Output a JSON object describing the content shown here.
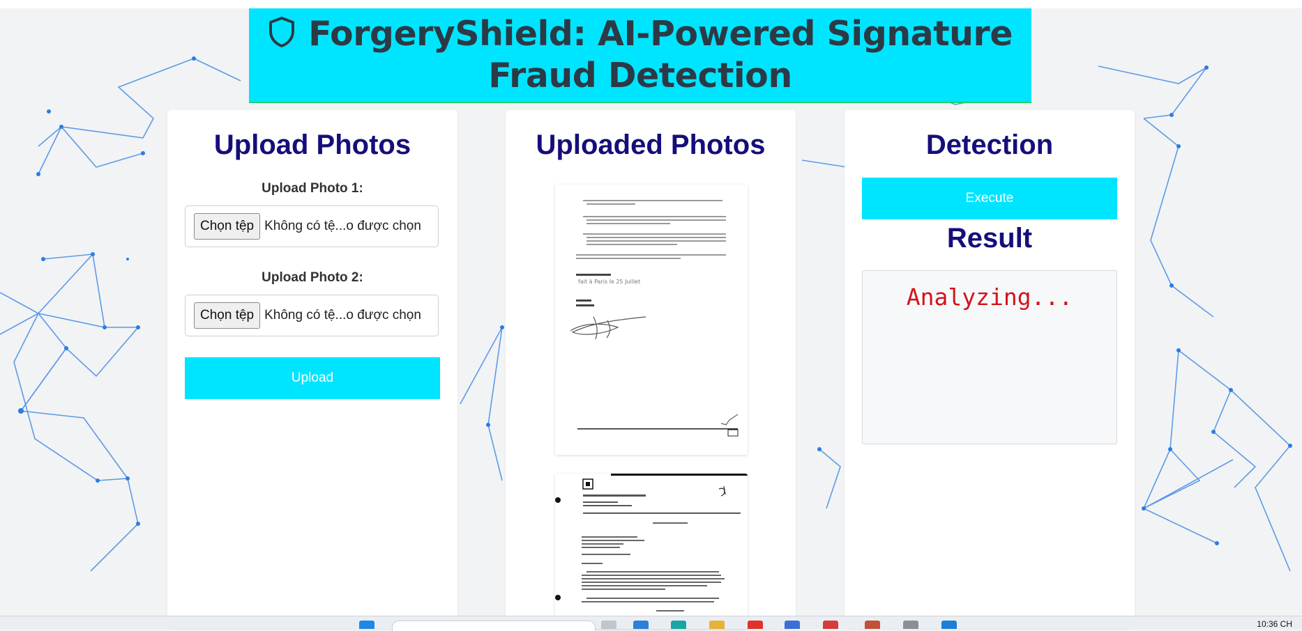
{
  "header": {
    "title": "ForgeryShield: AI-Powered Signature Fraud Detection",
    "icon": "shield-icon",
    "bg_color": "#00e5ff"
  },
  "upload_card": {
    "title": "Upload Photos",
    "photo1_label": "Upload Photo 1:",
    "photo2_label": "Upload Photo 2:",
    "choose_label": "Chọn tệp",
    "no_file_text": "Không có tệ...o được chọn",
    "upload_button": "Upload"
  },
  "uploaded_card": {
    "title": "Uploaded Photos",
    "images": [
      "document-signature-1",
      "document-letter-2"
    ]
  },
  "detection_card": {
    "title": "Detection",
    "execute_button": "Execute",
    "result_title": "Result",
    "result_text": "Analyzing..."
  },
  "taskbar": {
    "clock": "10:36 CH"
  },
  "colors": {
    "accent": "#00e5ff",
    "heading": "#150e7a",
    "result_text": "#d2141b",
    "network_lines": "#2a7de1"
  }
}
